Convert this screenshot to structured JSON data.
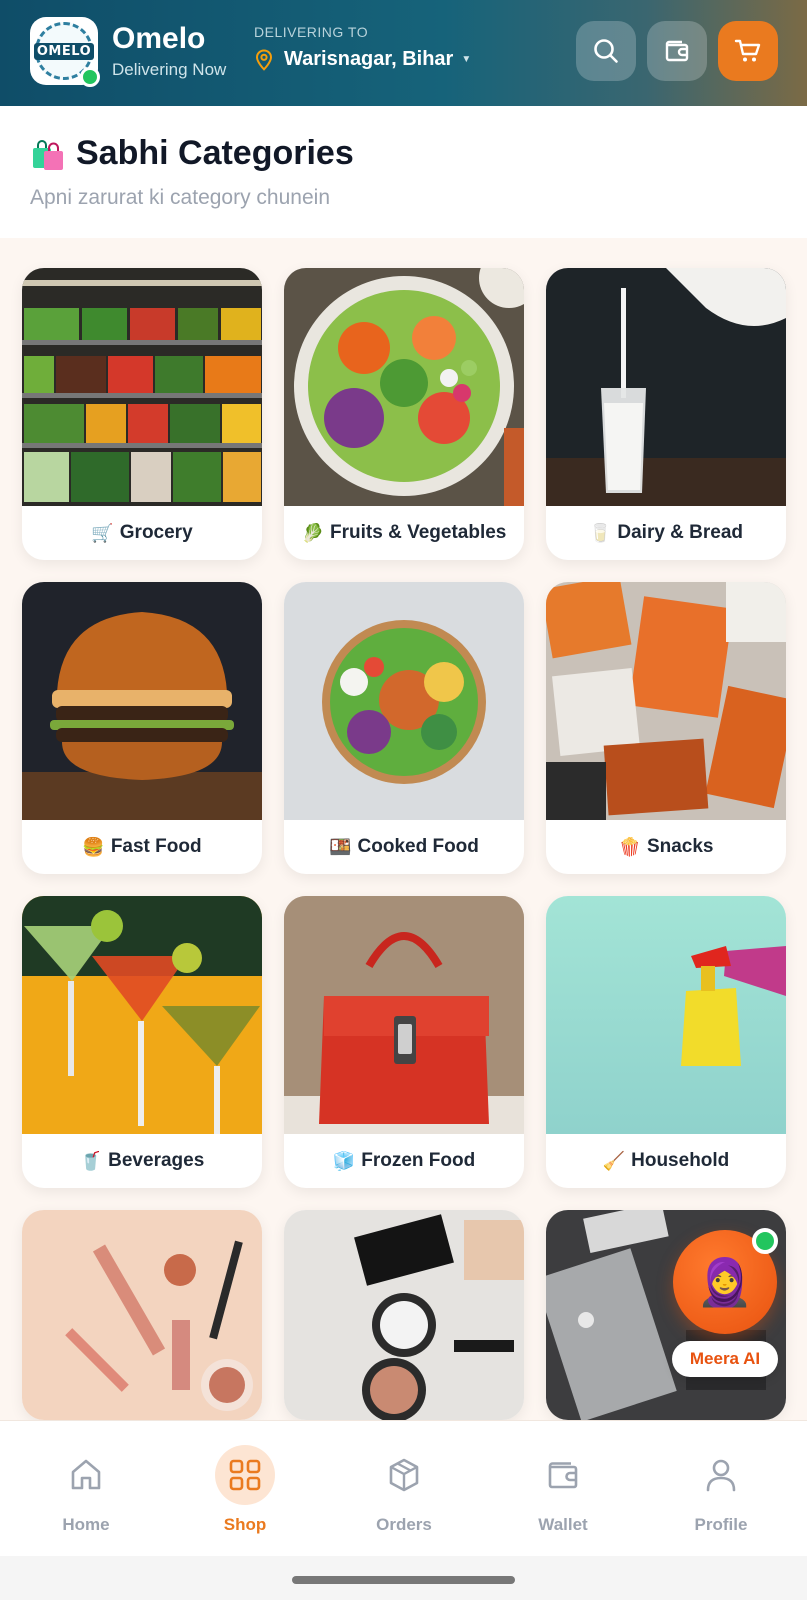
{
  "header": {
    "brand_name": "Omelo",
    "brand_sub": "Delivering Now",
    "logo_text": "OMELO",
    "delivering_label": "DELIVERING TO",
    "location": "Warisnagar, Bihar",
    "icons": [
      "search-icon",
      "wallet-icon",
      "cart-icon"
    ]
  },
  "section": {
    "title": "Sabhi Categories",
    "subtitle": "Apni zarurat ki category chunein"
  },
  "categories": [
    {
      "label": "Grocery",
      "emoji": "🛒"
    },
    {
      "label": "Fruits & Vegetables",
      "emoji": "🥬"
    },
    {
      "label": "Dairy & Bread",
      "emoji": "🥛"
    },
    {
      "label": "Fast Food",
      "emoji": "🍔"
    },
    {
      "label": "Cooked Food",
      "emoji": "🍱"
    },
    {
      "label": "Snacks",
      "emoji": "🍿"
    },
    {
      "label": "Beverages",
      "emoji": "🥤"
    },
    {
      "label": "Frozen Food",
      "emoji": "🧊"
    },
    {
      "label": "Household",
      "emoji": "🧹"
    }
  ],
  "assistant": {
    "label": "Meera AI",
    "emoji": "🧕"
  },
  "nav": [
    {
      "label": "Home",
      "icon": "home-icon",
      "active": false
    },
    {
      "label": "Shop",
      "icon": "grid-icon",
      "active": true
    },
    {
      "label": "Orders",
      "icon": "box-icon",
      "active": false
    },
    {
      "label": "Wallet",
      "icon": "wallet-icon",
      "active": false
    },
    {
      "label": "Profile",
      "icon": "user-icon",
      "active": false
    }
  ],
  "colors": {
    "accent": "#ea7a1f",
    "header_start": "#0f4d68",
    "status_green": "#22c55e"
  }
}
